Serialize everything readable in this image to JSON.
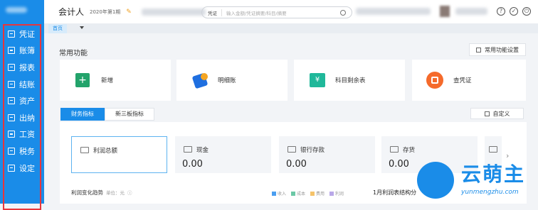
{
  "sidebar": {
    "items": [
      {
        "label": "凭证",
        "icon": "voucher-icon"
      },
      {
        "label": "账簿",
        "icon": "ledger-icon"
      },
      {
        "label": "报表",
        "icon": "report-icon"
      },
      {
        "label": "结账",
        "icon": "checkout-icon"
      },
      {
        "label": "资产",
        "icon": "asset-icon"
      },
      {
        "label": "出纳",
        "icon": "cashier-icon"
      },
      {
        "label": "工资",
        "icon": "salary-icon"
      },
      {
        "label": "税务",
        "icon": "tax-icon"
      },
      {
        "label": "设定",
        "icon": "settings-icon"
      }
    ]
  },
  "header": {
    "title": "会计人",
    "period": "2020年第1期",
    "search": {
      "type": "凭证",
      "placeholder": "输入金额/凭证摘要/科目/摘要"
    }
  },
  "tabs": {
    "home": "首页"
  },
  "quick": {
    "title": "常用功能",
    "settings": "常用功能设置",
    "items": [
      {
        "label": "新增",
        "color": "#23a36b"
      },
      {
        "label": "明细账",
        "color": "#1f6fe0"
      },
      {
        "label": "科目剩余表",
        "color": "#20b89a"
      },
      {
        "label": "查凭证",
        "color": "#f56a2b"
      }
    ]
  },
  "metrics": {
    "tabs": [
      "财务指标",
      "新三板指标"
    ],
    "custom": "自定义",
    "cards": [
      {
        "name": "利润总额",
        "value": ""
      },
      {
        "name": "现金",
        "value": "0.00"
      },
      {
        "name": "银行存款",
        "value": "0.00"
      },
      {
        "name": "存货",
        "value": "0.00"
      }
    ],
    "trend_title": "利润变化趋势",
    "trend_unit": "单位：元",
    "legend": [
      {
        "label": "收入",
        "color": "#4a9ef0"
      },
      {
        "label": "成本",
        "color": "#6cc8a6"
      },
      {
        "label": "费用",
        "color": "#f5c36a"
      },
      {
        "label": "利润",
        "color": "#b9a8e8"
      }
    ],
    "structure_title": "1月利润表结构分"
  },
  "watermark": {
    "brand": "云萌主",
    "url": "yunmengzhu.com"
  }
}
